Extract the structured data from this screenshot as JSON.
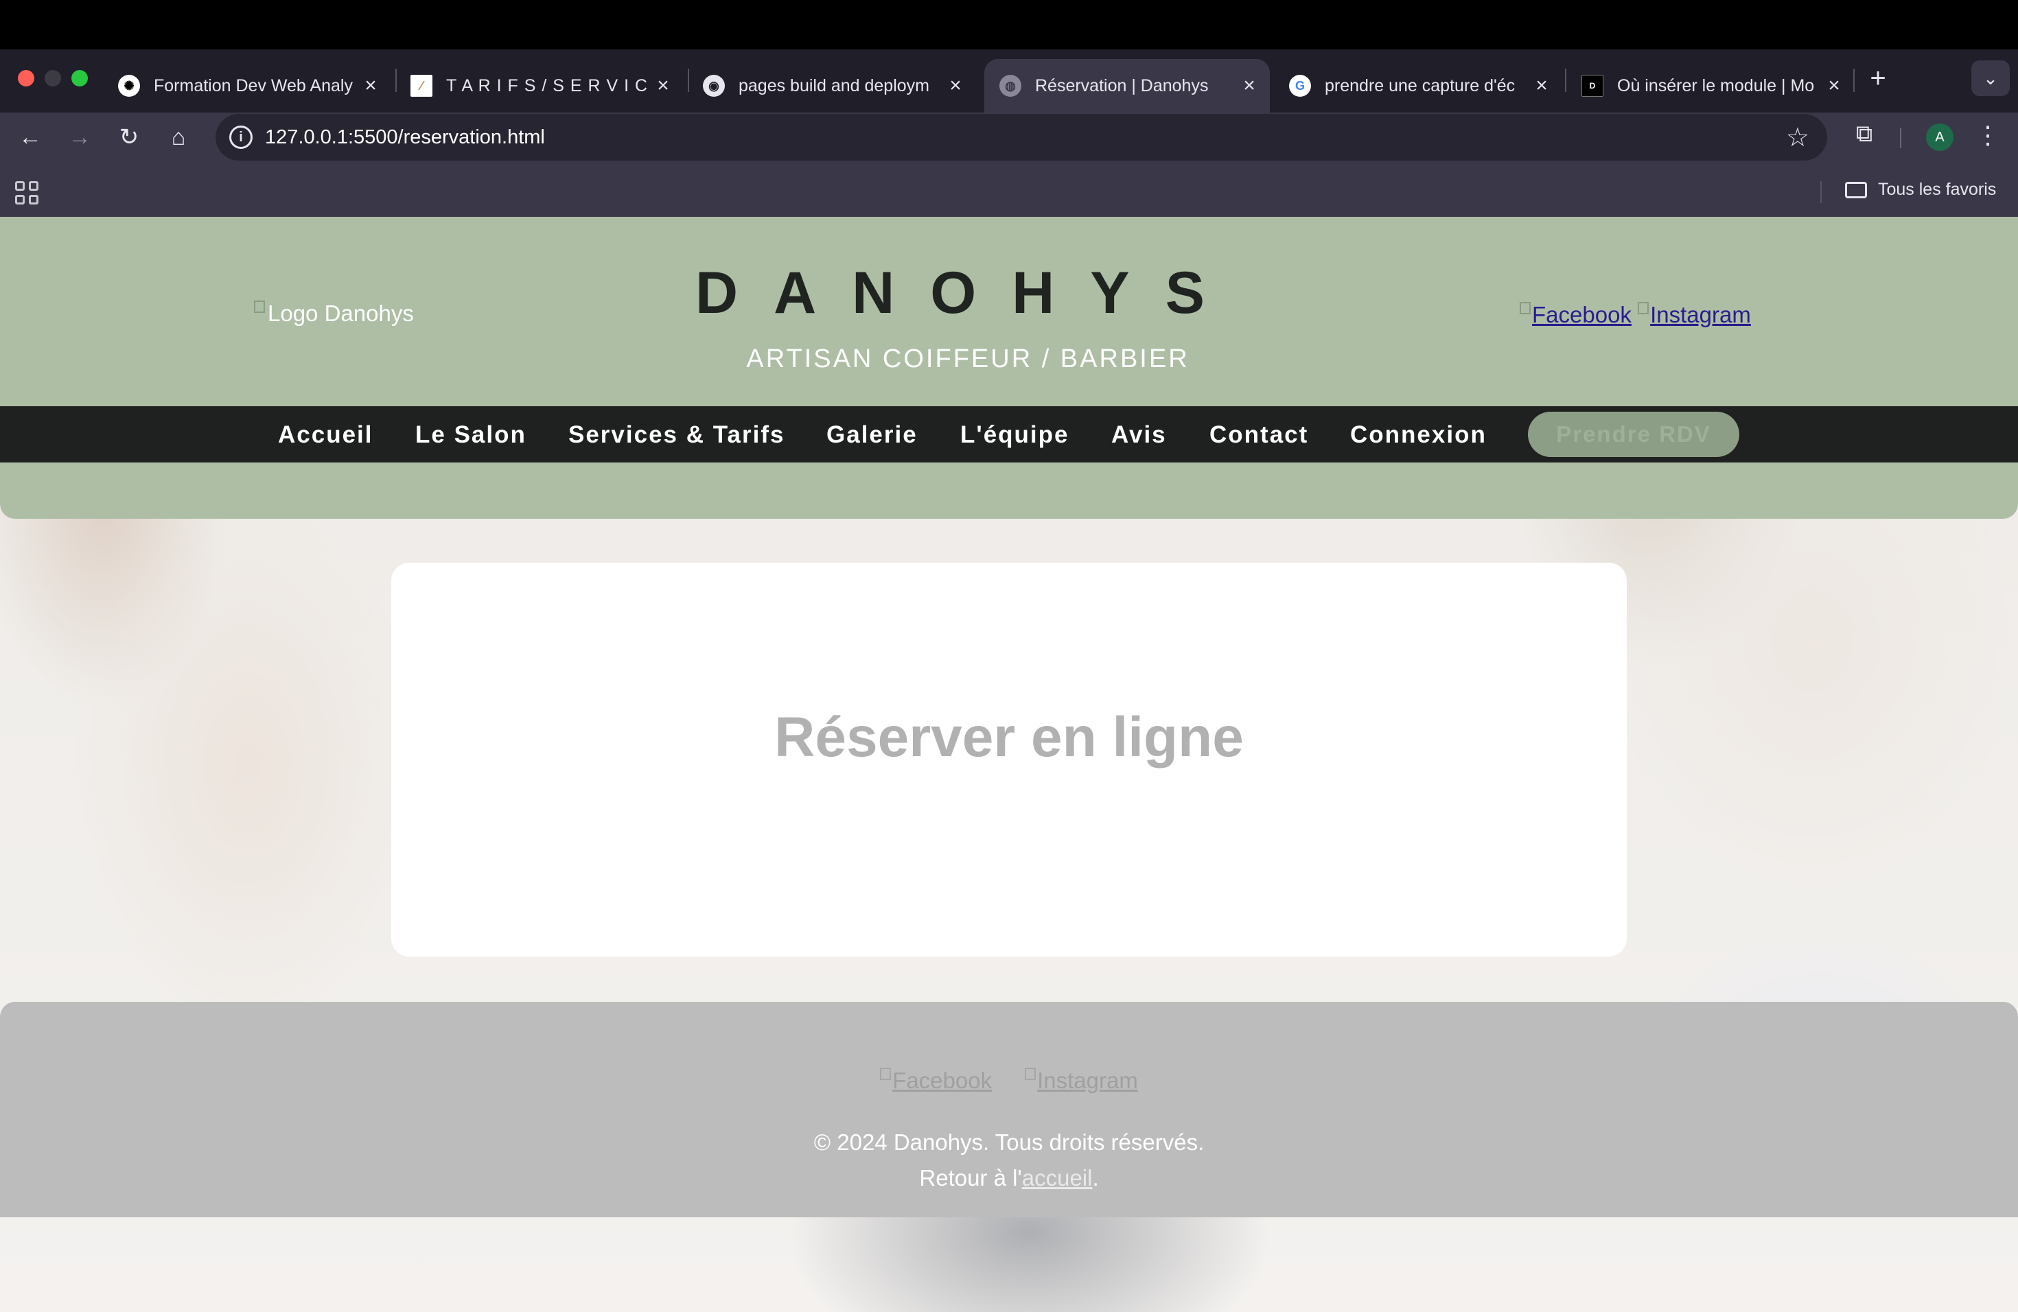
{
  "browser": {
    "tabs": [
      {
        "title": "Formation Dev Web Analy",
        "icon": "openai-icon",
        "active": false
      },
      {
        "title": "T A R I F S / S E R V I C E",
        "icon": "site-logo-icon",
        "active": false
      },
      {
        "title": "pages build and deploym",
        "icon": "github-icon",
        "active": false
      },
      {
        "title": "Réservation | Danohys",
        "icon": "globe-icon",
        "active": true
      },
      {
        "title": "prendre une capture d'éc",
        "icon": "google-icon",
        "active": false
      },
      {
        "title": "Où insérer le module | Mo",
        "icon": "site-icon",
        "active": false
      }
    ],
    "url": "127.0.0.1:5500/reservation.html",
    "profile_initial": "A",
    "bookmarks_all_label": "Tous les favoris"
  },
  "header": {
    "logo_alt": "Logo Danohys",
    "title": "DANOHYS",
    "subtitle": "ARTISAN COIFFEUR / BARBIER",
    "social": {
      "facebook": "Facebook",
      "instagram": "Instagram"
    }
  },
  "nav": {
    "items": [
      "Accueil",
      "Le Salon",
      "Services & Tarifs",
      "Galerie",
      "L'équipe",
      "Avis",
      "Contact",
      "Connexion"
    ],
    "cta": "Prendre RDV"
  },
  "main": {
    "title": "Réserver en ligne"
  },
  "footer": {
    "social": {
      "facebook": "Facebook",
      "instagram": "Instagram"
    },
    "copyright": "© 2024 Danohys. Tous droits réservés.",
    "back_prefix": "Retour à l'",
    "back_link": "accueil",
    "back_suffix": "."
  },
  "colors": {
    "header_bg": "#adbea5",
    "nav_bg": "#1f2020",
    "cta_bg": "#8d9e86",
    "footer_bg": "#bcbcbc",
    "card_bg": "#ffffff"
  }
}
